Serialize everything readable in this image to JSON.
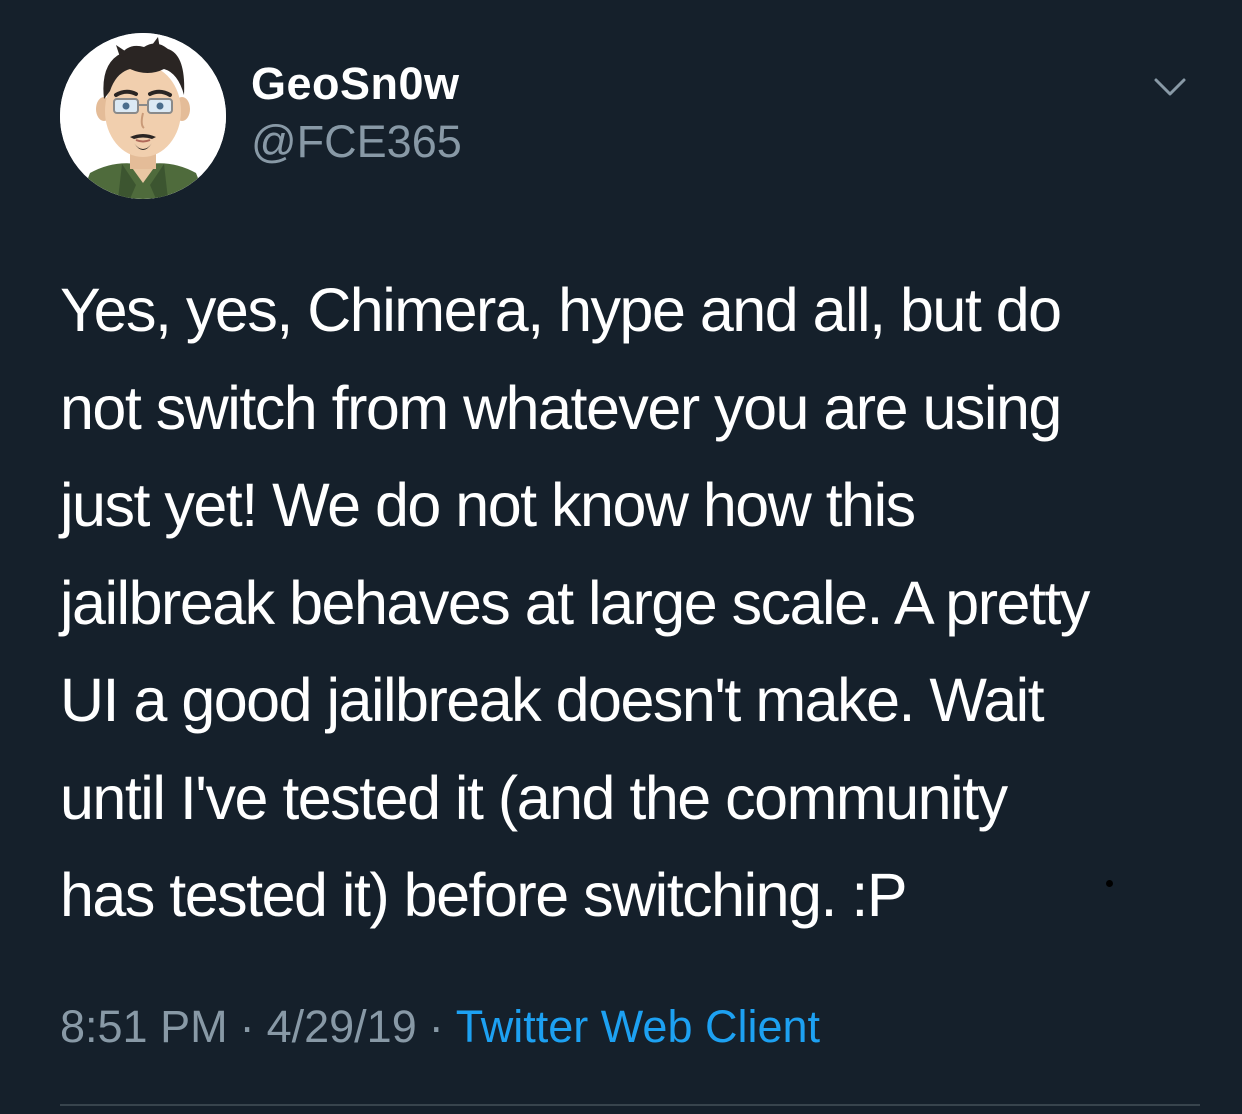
{
  "colors": {
    "background": "#15202b",
    "primary_text": "#ffffff",
    "secondary_text": "#8899a6",
    "link": "#1da1f2",
    "divider": "#38444d"
  },
  "author": {
    "display_name": "GeoSn0w",
    "handle": "@FCE365",
    "avatar_icon": "cartoon-avatar"
  },
  "menu": {
    "icon": "chevron-down-icon"
  },
  "tweet": {
    "lines": [
      "Yes, yes, Chimera, hype and all, but do",
      "not switch from whatever you are using",
      "just yet! We do not know how this",
      "jailbreak behaves at large scale. A pretty",
      "UI a good jailbreak doesn't make. Wait",
      "until I've tested it (and the community",
      "has tested it) before switching. :P"
    ]
  },
  "meta": {
    "time": "8:51 PM",
    "separator": "·",
    "date": "4/29/19",
    "source": "Twitter Web Client"
  }
}
